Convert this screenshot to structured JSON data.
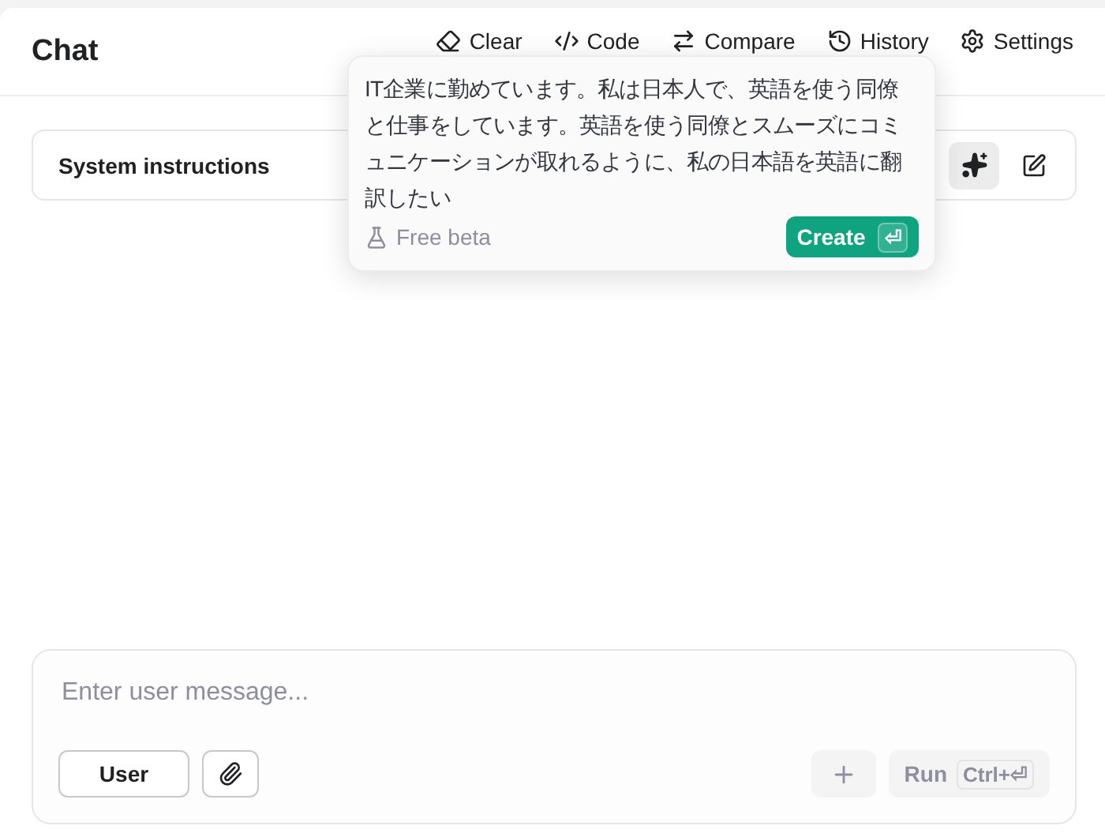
{
  "header": {
    "title": "Chat",
    "actions": [
      {
        "kind": "clear",
        "label": "Clear"
      },
      {
        "kind": "code",
        "label": "Code"
      },
      {
        "kind": "compare",
        "label": "Compare"
      },
      {
        "kind": "history",
        "label": "History"
      },
      {
        "kind": "settings",
        "label": "Settings"
      }
    ]
  },
  "system_instructions": {
    "label": "System instructions"
  },
  "popover": {
    "text": "IT企業に勤めています。私は日本人で、英語を使う同僚と仕事をしています。英語を使う同僚とスムーズにコミュニケーションが取れるように、私の日本語を英語に翻訳したい",
    "note": "Free beta",
    "button": {
      "label": "Create",
      "key": "⏎"
    }
  },
  "composer": {
    "placeholder": "Enter user message...",
    "role": "User",
    "add_disabled": true,
    "run": {
      "label": "Run",
      "key": "Ctrl+⏎",
      "disabled": true
    }
  }
}
